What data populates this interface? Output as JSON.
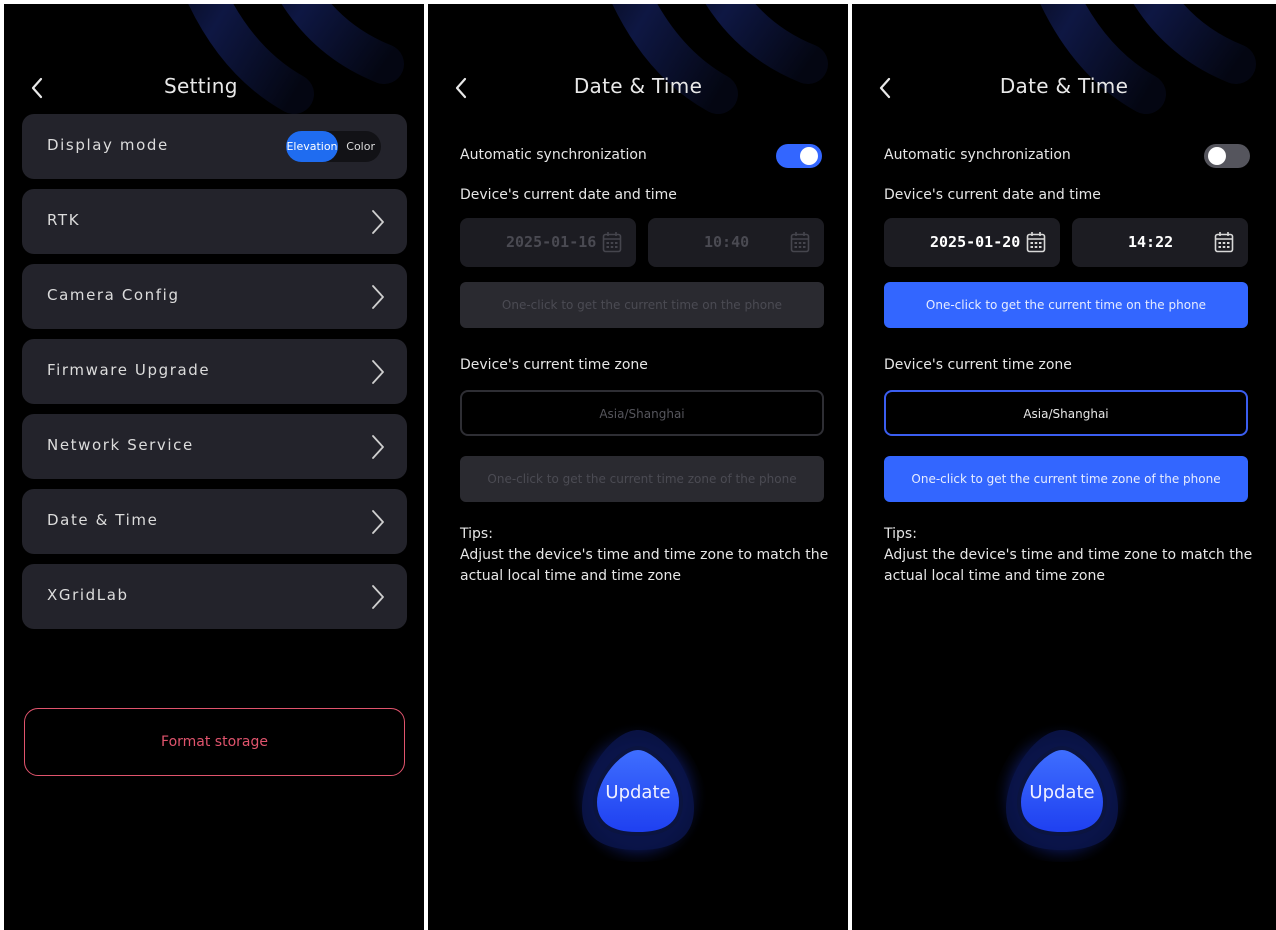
{
  "colors": {
    "accent": "#3366ff",
    "danger": "#e0546d",
    "row_bg": "#23232b",
    "screen_bg": "#000000"
  },
  "settings": {
    "title": "Setting",
    "display_mode": {
      "label": "Display mode",
      "options": [
        "Elevation",
        "Color"
      ],
      "selected": "Elevation"
    },
    "items": [
      {
        "label": "RTK"
      },
      {
        "label": "Camera Config"
      },
      {
        "label": "Firmware Upgrade"
      },
      {
        "label": "Network Service"
      },
      {
        "label": "Date & Time"
      },
      {
        "label": "XGridLab"
      }
    ],
    "format_label": "Format storage"
  },
  "datetime_auto": {
    "title": "Date & Time",
    "sync_label": "Automatic synchronization",
    "sync_enabled": true,
    "current_label": "Device's current date and time",
    "date": "2025-01-16",
    "time": "10:40",
    "get_time_btn": "One-click to get the current time on the phone",
    "tz_label": "Device's current time zone",
    "timezone": "Asia/Shanghai",
    "get_tz_btn": "One-click to get the current time zone of the phone",
    "tips_title": "Tips:",
    "tips_text": "Adjust the device's time and time zone to match the actual local time and time zone",
    "update_label": "Update"
  },
  "datetime_manual": {
    "title": "Date & Time",
    "sync_label": "Automatic synchronization",
    "sync_enabled": false,
    "current_label": "Device's current date and time",
    "date": "2025-01-20",
    "time": "14:22",
    "get_time_btn": "One-click to get the current time on the phone",
    "tz_label": "Device's current time zone",
    "timezone": "Asia/Shanghai",
    "get_tz_btn": "One-click to get the current time zone of the phone",
    "tips_title": "Tips:",
    "tips_text": "Adjust the device's time and time zone to match the actual local time and time zone",
    "update_label": "Update"
  },
  "icons": [
    "chevron-left-icon",
    "chevron-right-icon",
    "calendar-icon"
  ]
}
